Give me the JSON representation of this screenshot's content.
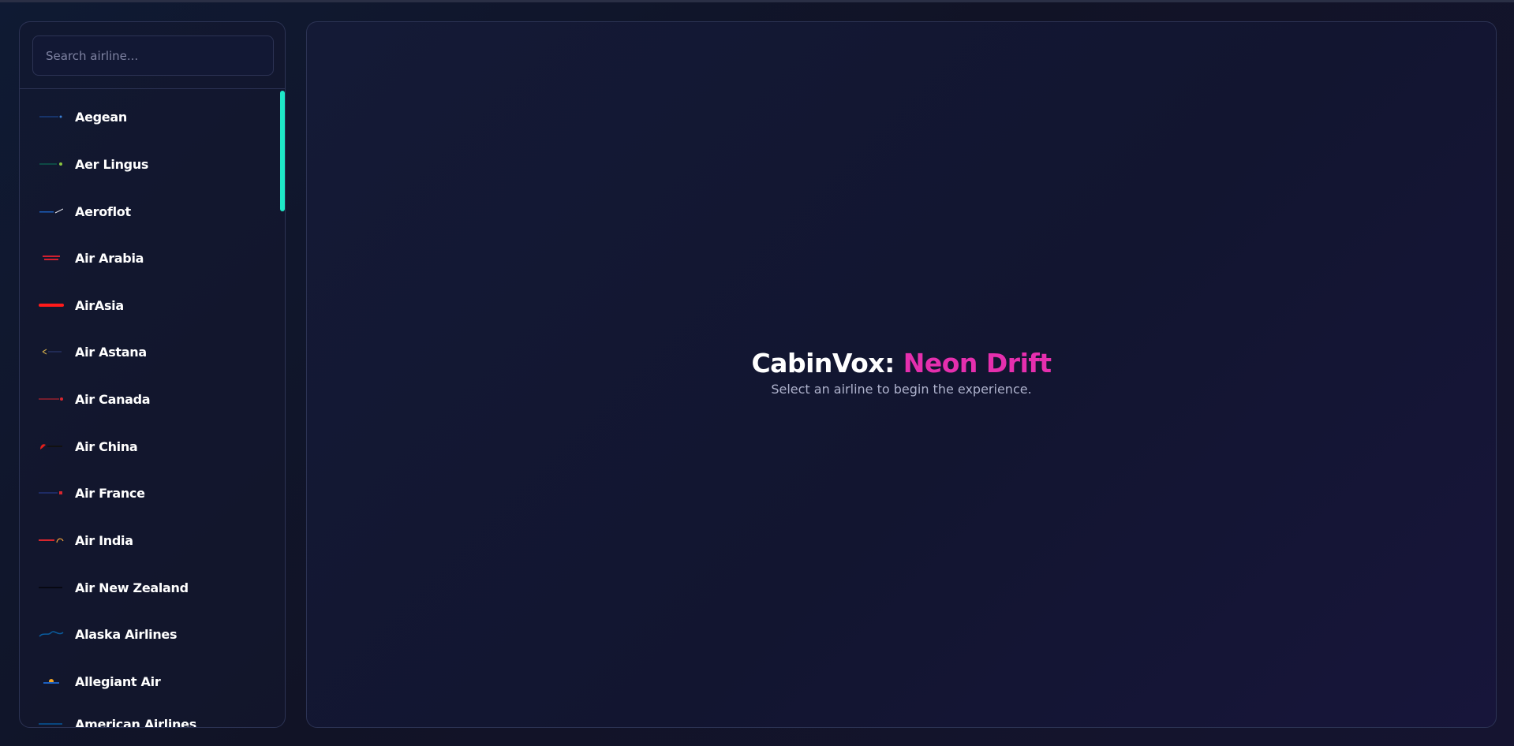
{
  "search": {
    "placeholder": "Search airline..."
  },
  "airlines": [
    {
      "label": "Aegean",
      "logo_color": "#1d4fa3"
    },
    {
      "label": "Aer Lingus",
      "logo_color": "#0a7a5a"
    },
    {
      "label": "Aeroflot",
      "logo_color": "#1c5fbf"
    },
    {
      "label": "Air Arabia",
      "logo_color": "#d1202f"
    },
    {
      "label": "AirAsia",
      "logo_color": "#ff1a1a"
    },
    {
      "label": "Air Astana",
      "logo_color": "#c9a64a"
    },
    {
      "label": "Air Canada",
      "logo_color": "#d8262e"
    },
    {
      "label": "Air China",
      "logo_color": "#e3201b"
    },
    {
      "label": "Air France",
      "logo_color": "#2a3f9a"
    },
    {
      "label": "Air India",
      "logo_color": "#d7262d"
    },
    {
      "label": "Air New Zealand",
      "logo_color": "#000000"
    },
    {
      "label": "Alaska Airlines",
      "logo_color": "#0a5c9e"
    },
    {
      "label": "Allegiant Air",
      "logo_color": "#f5a623"
    },
    {
      "label": "American Airlines",
      "logo_color": "#0078d2"
    }
  ],
  "hero": {
    "title_prefix": "CabinVox: ",
    "title_accent": "Neon Drift",
    "subtitle": "Select an airline to begin the experience."
  },
  "colors": {
    "accent": "#e52fae",
    "scrollbar": "#1ee8c7",
    "panel_border": "#2c3354"
  }
}
